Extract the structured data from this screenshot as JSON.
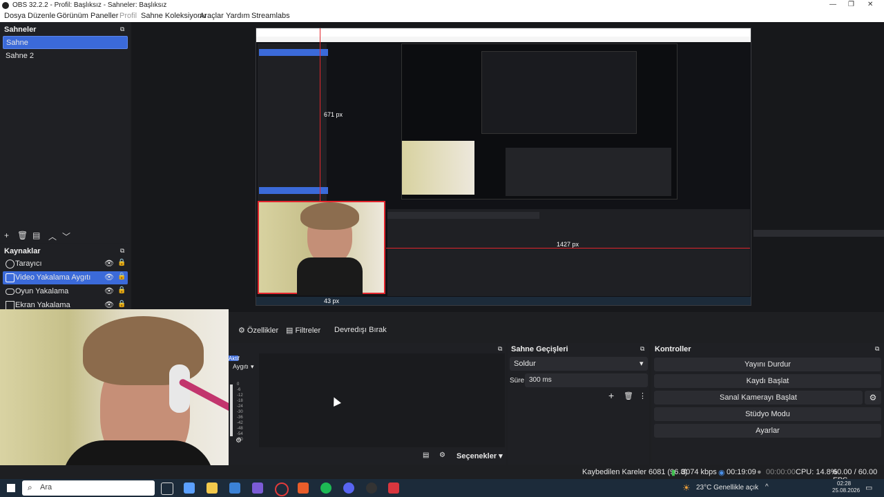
{
  "window": {
    "title": "OBS 32.2.2 - Profil: Başlıksız - Sahneler: Başlıksız"
  },
  "menu": [
    "Dosya",
    "Düzenle",
    "Görünüm",
    "Paneller",
    "Profil",
    "Sahne Koleksiyonu",
    "Araçlar",
    "Yardım",
    "Streamlabs"
  ],
  "scenes": {
    "title": "Sahneler",
    "items": [
      "Sahne",
      "Sahne 2"
    ],
    "selected": 0
  },
  "sources": {
    "title": "Kaynaklar",
    "items": [
      "Tarayıcı",
      "Video Yakalama Aygıtı",
      "Oyun Yakalama",
      "Ekran Yakalama"
    ],
    "selected": 1
  },
  "preview": {
    "guide_h": "1427 px",
    "guide_v": "671 px",
    "guide_small": "43 px"
  },
  "tabs": {
    "properties": "Özellikler",
    "filters": "Filtreler",
    "deactivate": "Devredışı Bırak"
  },
  "mixer": {
    "tag": "Aktif",
    "device": "Aygıtı",
    "ticks": [
      "0",
      "-6",
      "-12",
      "-18",
      "-24",
      "-30",
      "-36",
      "-42",
      "-48",
      "-54",
      "-60"
    ],
    "options_label": "Seçenekler"
  },
  "transitions": {
    "title": "Sahne Geçişleri",
    "selected": "Soldur",
    "duration_label": "Süre",
    "duration_value": "300 ms"
  },
  "controls": {
    "title": "Kontroller",
    "buttons": [
      "Yayını Durdur",
      "Kaydı Başlat",
      "Sanal Kamerayı Başlat",
      "Stüdyo Modu",
      "Ayarlar"
    ]
  },
  "status": {
    "dropped": "Kaybedilen Kareler 6081 (96.8)",
    "bitrate": "3074 kbps",
    "stream_time": "00:19:09",
    "rec_time": "00:00:00",
    "cpu": "CPU: 14.8%",
    "fps": "60.00 / 60.00 FPS"
  },
  "taskbar": {
    "search_placeholder": "Ara",
    "weather": "23°C  Genellikle açık",
    "time": "02:28",
    "date": "25.08.2026"
  },
  "colors": {
    "accent": "#3b6ad9",
    "guide": "#e3262d"
  }
}
